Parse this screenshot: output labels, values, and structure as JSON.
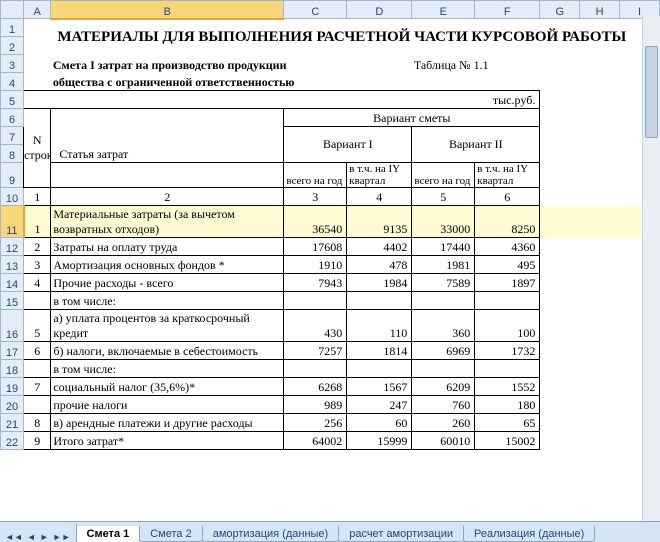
{
  "columns": [
    "",
    "A",
    "B",
    "C",
    "D",
    "E",
    "F",
    "G",
    "H",
    "I"
  ],
  "title": "МАТЕРИАЛЫ ДЛЯ ВЫПОЛНЕНИЯ РАСЧЕТНОЙ ЧАСТИ КУРСОВОЙ РАБОТЫ",
  "table_label": "Таблица № 1.1",
  "sub1": "Смета I затрат на производство продукции",
  "sub2": "общества с ограниченной ответственностью",
  "units": "тыс.руб.",
  "hdr": {
    "n": "N строки",
    "article": "Статья затрат",
    "variant": "Вариант сметы",
    "v1": "Вариант I",
    "v2": "Вариант II",
    "total": "всего на год",
    "inq": "в т.ч. на IY квартал"
  },
  "colnums": {
    "c1": "1",
    "c2": "2",
    "c3": "3",
    "c4": "4",
    "c5": "5",
    "c6": "6"
  },
  "rows": [
    {
      "n": "1",
      "label": "Материальные затраты (за вычетом возвратных отходов)",
      "v": [
        "36540",
        "9135",
        "33000",
        "8250"
      ],
      "wrap": true
    },
    {
      "n": "2",
      "label": "Затраты на оплату труда",
      "v": [
        "17608",
        "4402",
        "17440",
        "4360"
      ]
    },
    {
      "n": "3",
      "label": "Амортизация основных фондов *",
      "v": [
        "1910",
        "478",
        "1981",
        "495"
      ]
    },
    {
      "n": "4",
      "label": "Прочие расходы - всего",
      "v": [
        "7943",
        "1984",
        "7589",
        "1897"
      ]
    },
    {
      "n": "",
      "label": "в том числе:",
      "v": [
        "",
        "",
        "",
        ""
      ]
    },
    {
      "n": "5",
      "label": "а) уплата процентов за краткосрочный кредит",
      "v": [
        "430",
        "110",
        "360",
        "100"
      ],
      "wrap": true
    },
    {
      "n": "6",
      "label": "б) налоги, включаемые в себестоимость",
      "v": [
        "7257",
        "1814",
        "6969",
        "1732"
      ]
    },
    {
      "n": "",
      "label": "в том числе:",
      "v": [
        "",
        "",
        "",
        ""
      ]
    },
    {
      "n": "7",
      "label": "   социальный налог (35,6%)*",
      "v": [
        "6268",
        "1567",
        "6209",
        "1552"
      ]
    },
    {
      "n": "",
      "label": "   прочие налоги",
      "v": [
        "989",
        "247",
        "760",
        "180"
      ]
    },
    {
      "n": "8",
      "label": "в) арендные платежи и другие расходы",
      "v": [
        "256",
        "60",
        "260",
        "65"
      ]
    },
    {
      "n": "9",
      "label": "Итого затрат*",
      "v": [
        "64002",
        "15999",
        "60010",
        "15002"
      ],
      "cut": true
    }
  ],
  "rownums": [
    "1",
    "2",
    "3",
    "4",
    "5",
    "6",
    "7",
    "8",
    "9",
    "10",
    "11",
    "12",
    "13",
    "14",
    "15",
    "16",
    "17",
    "18",
    "19",
    "20",
    "21",
    "22"
  ],
  "sheets": [
    "Смета 1",
    "Смета 2",
    "амортизация (данные)",
    "расчет амортизации",
    "Реализация (данные)"
  ],
  "active_sheet": 0,
  "chart_data": {
    "type": "table",
    "title": "Смета I затрат на производство продукции общества с ограниченной ответственностью (тыс.руб.)",
    "columns": [
      "N строки",
      "Статья затрат",
      "Вариант I всего на год",
      "Вариант I в т.ч. на IY квартал",
      "Вариант II всего на год",
      "Вариант II в т.ч. на IY квартал"
    ],
    "rows": [
      [
        1,
        "Материальные затраты (за вычетом возвратных отходов)",
        36540,
        9135,
        33000,
        8250
      ],
      [
        2,
        "Затраты на оплату труда",
        17608,
        4402,
        17440,
        4360
      ],
      [
        3,
        "Амортизация основных фондов *",
        1910,
        478,
        1981,
        495
      ],
      [
        4,
        "Прочие расходы - всего",
        7943,
        1984,
        7589,
        1897
      ],
      [
        null,
        "в том числе:",
        null,
        null,
        null,
        null
      ],
      [
        5,
        "а) уплата процентов за краткосрочный кредит",
        430,
        110,
        360,
        100
      ],
      [
        6,
        "б) налоги, включаемые в себестоимость",
        7257,
        1814,
        6969,
        1732
      ],
      [
        null,
        "в том числе:",
        null,
        null,
        null,
        null
      ],
      [
        7,
        "социальный налог (35,6%)*",
        6268,
        1567,
        6209,
        1552
      ],
      [
        null,
        "прочие налоги",
        989,
        247,
        760,
        180
      ],
      [
        8,
        "в) арендные платежи и другие расходы",
        256,
        60,
        260,
        65
      ],
      [
        9,
        "Итого затрат*",
        64002,
        15999,
        60010,
        15002
      ]
    ]
  }
}
